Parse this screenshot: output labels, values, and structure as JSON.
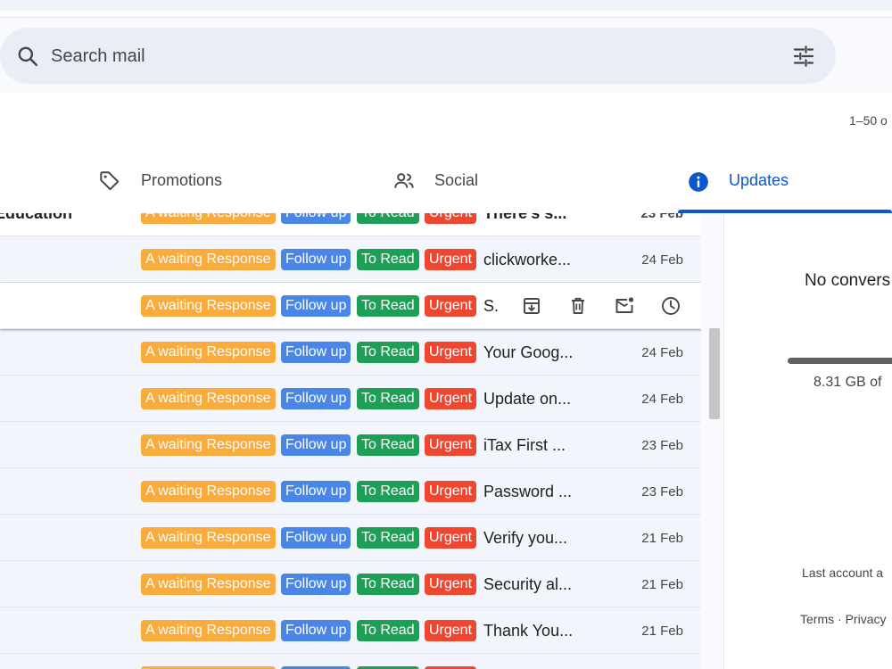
{
  "search": {
    "placeholder": "Search mail"
  },
  "pagination": {
    "text": "1–50 o"
  },
  "tabs": [
    {
      "label": "Promotions",
      "icon": "tag-icon",
      "active": false
    },
    {
      "label": "Social",
      "icon": "people-icon",
      "active": false
    },
    {
      "label": "Updates",
      "icon": "info-icon",
      "active": true
    }
  ],
  "labels": {
    "awaiting": "A waiting Response",
    "followup": "Follow up",
    "toread": "To Read",
    "urgent": "Urgent"
  },
  "label_colors": {
    "awaiting": "#fbaa3c",
    "followup": "#4a86e8",
    "toread": "#1e9f56",
    "urgent": "#f0462f"
  },
  "emails": [
    {
      "sender": "Education",
      "subject": "There's s...",
      "date": "23 Feb",
      "unread": true
    },
    {
      "sender": "",
      "subject": "clickworke...",
      "date": "24 Feb",
      "unread": false
    },
    {
      "sender": "",
      "subject": "S.",
      "date": "",
      "unread": false,
      "hovered": true
    },
    {
      "sender": "",
      "subject": "Your Goog...",
      "date": "24 Feb",
      "unread": false
    },
    {
      "sender": "",
      "subject": "Update on...",
      "date": "24 Feb",
      "unread": false
    },
    {
      "sender": "",
      "subject": "iTax First ...",
      "date": "23 Feb",
      "unread": false
    },
    {
      "sender": "",
      "subject": "Password ...",
      "date": "23 Feb",
      "unread": false
    },
    {
      "sender": "",
      "subject": "Verify you...",
      "date": "21 Feb",
      "unread": false
    },
    {
      "sender": "",
      "subject": "Security al...",
      "date": "21 Feb",
      "unread": false
    },
    {
      "sender": "",
      "subject": "Thank You...",
      "date": "21 Feb",
      "unread": false
    },
    {
      "sender": "",
      "subject": "",
      "date": "",
      "unread": false
    }
  ],
  "hover_actions": [
    "archive-icon",
    "delete-icon",
    "mark-unread-icon",
    "snooze-icon"
  ],
  "right_panel": {
    "empty_message": "No convers",
    "storage": "8.31 GB of",
    "last_activity": "Last account a",
    "terms": "Terms",
    "separator": "·",
    "privacy": "Privacy"
  }
}
